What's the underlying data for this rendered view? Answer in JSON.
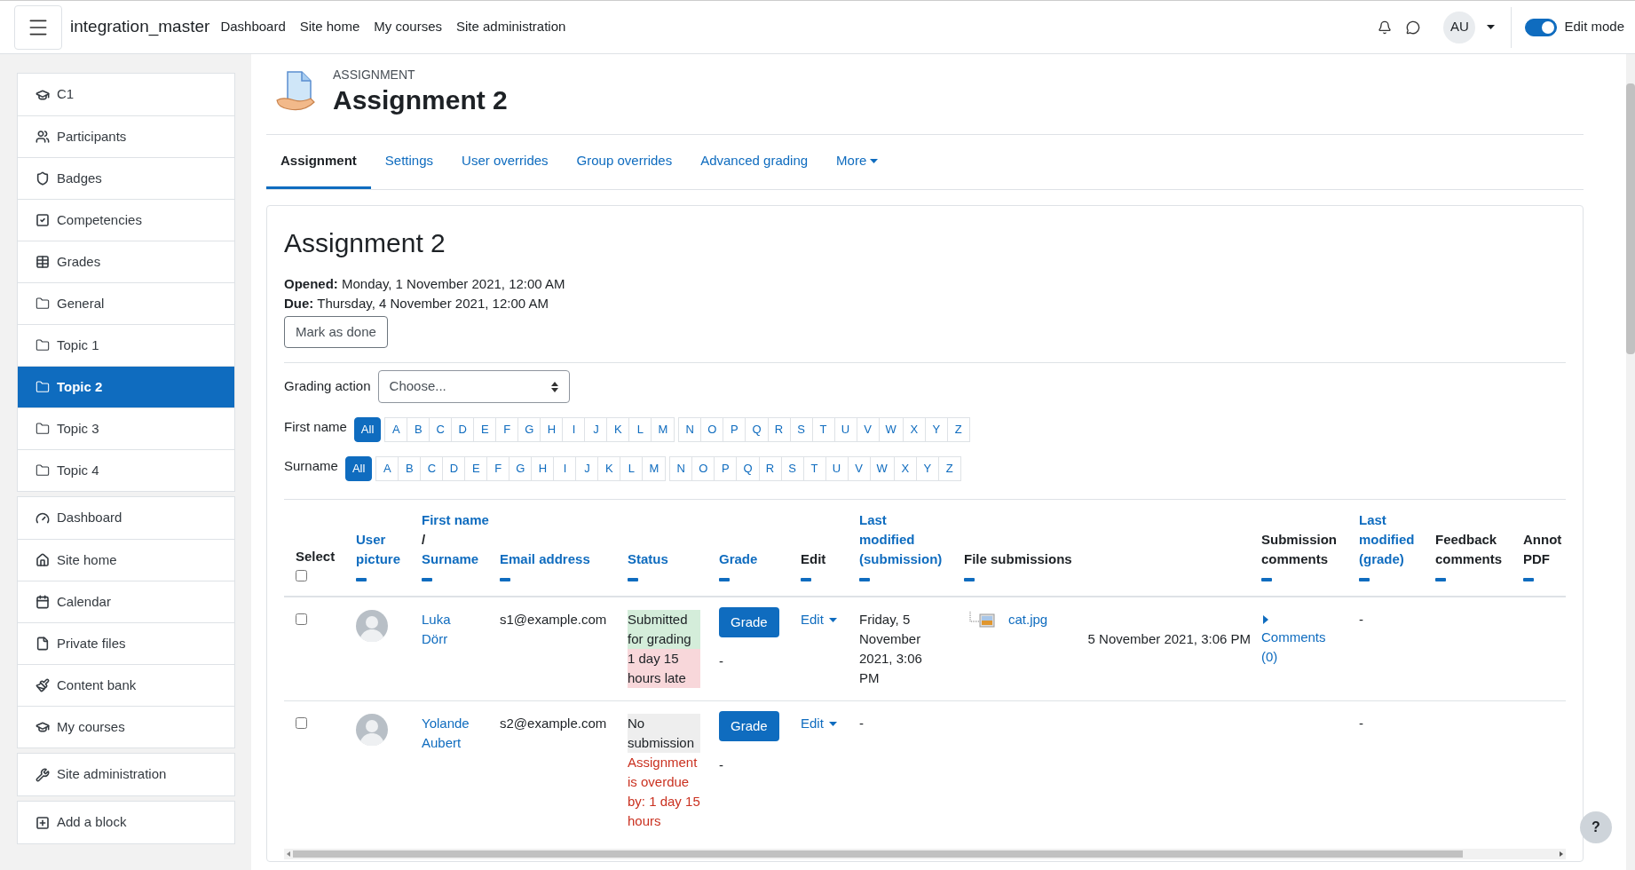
{
  "nav": {
    "site_name": "integration_master",
    "links": [
      "Dashboard",
      "Site home",
      "My courses",
      "Site administration"
    ],
    "avatar": "AU",
    "edit_mode": {
      "label": "Edit mode",
      "on": true
    }
  },
  "sidebar": {
    "groups": [
      [
        {
          "label": "C1",
          "kind": "course",
          "selected": false
        },
        {
          "label": "Participants",
          "kind": "participants",
          "selected": false
        },
        {
          "label": "Badges",
          "kind": "badges",
          "selected": false
        },
        {
          "label": "Competencies",
          "kind": "competencies",
          "selected": false
        },
        {
          "label": "Grades",
          "kind": "grades",
          "selected": false
        },
        {
          "label": "General",
          "kind": "folder",
          "selected": false
        },
        {
          "label": "Topic 1",
          "kind": "folder",
          "selected": false
        },
        {
          "label": "Topic 2",
          "kind": "folder",
          "selected": true
        },
        {
          "label": "Topic 3",
          "kind": "folder",
          "selected": false
        },
        {
          "label": "Topic 4",
          "kind": "folder",
          "selected": false
        }
      ],
      [
        {
          "label": "Dashboard",
          "kind": "dashboard",
          "selected": false
        },
        {
          "label": "Site home",
          "kind": "home",
          "selected": false
        },
        {
          "label": "Calendar",
          "kind": "calendar",
          "selected": false
        },
        {
          "label": "Private files",
          "kind": "file",
          "selected": false
        },
        {
          "label": "Content bank",
          "kind": "brush",
          "selected": false
        },
        {
          "label": "My courses",
          "kind": "course",
          "selected": false
        }
      ],
      [
        {
          "label": "Site administration",
          "kind": "admin",
          "selected": false
        }
      ],
      [
        {
          "label": "Add a block",
          "kind": "add",
          "selected": false
        }
      ]
    ]
  },
  "header": {
    "kicker": "ASSIGNMENT",
    "title": "Assignment 2"
  },
  "tabs": [
    {
      "label": "Assignment",
      "selected": true,
      "kind": "tab"
    },
    {
      "label": "Settings",
      "selected": false,
      "kind": "tab"
    },
    {
      "label": "User overrides",
      "selected": false,
      "kind": "tab"
    },
    {
      "label": "Group overrides",
      "selected": false,
      "kind": "tab"
    },
    {
      "label": "Advanced grading",
      "selected": false,
      "kind": "tab"
    },
    {
      "label": "More",
      "selected": false,
      "kind": "dropdown"
    }
  ],
  "card": {
    "title": "Assignment 2",
    "dates": [
      {
        "label": "Opened:",
        "value": "Monday, 1 November 2021, 12:00 AM"
      },
      {
        "label": "Due:",
        "value": "Thursday, 4 November 2021, 12:00 AM"
      }
    ],
    "mark_done": "Mark as done",
    "grading_action": {
      "label": "Grading action",
      "value": "Choose..."
    },
    "filters": [
      {
        "label": "First name",
        "groups": [
          [
            {
              "label": "All",
              "selected": true
            }
          ],
          [
            {
              "label": "A",
              "selected": false
            },
            {
              "label": "B",
              "selected": false
            },
            {
              "label": "C",
              "selected": false
            },
            {
              "label": "D",
              "selected": false
            },
            {
              "label": "E",
              "selected": false
            },
            {
              "label": "F",
              "selected": false
            },
            {
              "label": "G",
              "selected": false
            },
            {
              "label": "H",
              "selected": false
            },
            {
              "label": "I",
              "selected": false
            },
            {
              "label": "J",
              "selected": false
            },
            {
              "label": "K",
              "selected": false
            },
            {
              "label": "L",
              "selected": false
            },
            {
              "label": "M",
              "selected": false
            }
          ],
          [
            {
              "label": "N",
              "selected": false
            },
            {
              "label": "O",
              "selected": false
            },
            {
              "label": "P",
              "selected": false
            },
            {
              "label": "Q",
              "selected": false
            },
            {
              "label": "R",
              "selected": false
            },
            {
              "label": "S",
              "selected": false
            },
            {
              "label": "T",
              "selected": false
            },
            {
              "label": "U",
              "selected": false
            },
            {
              "label": "V",
              "selected": false
            },
            {
              "label": "W",
              "selected": false
            },
            {
              "label": "X",
              "selected": false
            },
            {
              "label": "Y",
              "selected": false
            },
            {
              "label": "Z",
              "selected": false
            }
          ]
        ]
      },
      {
        "label": "Surname",
        "groups": [
          [
            {
              "label": "All",
              "selected": true
            }
          ],
          [
            {
              "label": "A",
              "selected": false
            },
            {
              "label": "B",
              "selected": false
            },
            {
              "label": "C",
              "selected": false
            },
            {
              "label": "D",
              "selected": false
            },
            {
              "label": "E",
              "selected": false
            },
            {
              "label": "F",
              "selected": false
            },
            {
              "label": "G",
              "selected": false
            },
            {
              "label": "H",
              "selected": false
            },
            {
              "label": "I",
              "selected": false
            },
            {
              "label": "J",
              "selected": false
            },
            {
              "label": "K",
              "selected": false
            },
            {
              "label": "L",
              "selected": false
            },
            {
              "label": "M",
              "selected": false
            }
          ],
          [
            {
              "label": "N",
              "selected": false
            },
            {
              "label": "O",
              "selected": false
            },
            {
              "label": "P",
              "selected": false
            },
            {
              "label": "Q",
              "selected": false
            },
            {
              "label": "R",
              "selected": false
            },
            {
              "label": "S",
              "selected": false
            },
            {
              "label": "T",
              "selected": false
            },
            {
              "label": "U",
              "selected": false
            },
            {
              "label": "V",
              "selected": false
            },
            {
              "label": "W",
              "selected": false
            },
            {
              "label": "X",
              "selected": false
            },
            {
              "label": "Y",
              "selected": false
            },
            {
              "label": "Z",
              "selected": false
            }
          ]
        ]
      }
    ]
  },
  "table": {
    "columns": [
      {
        "kind": "select",
        "label": "Select",
        "checked": false
      },
      {
        "kind": "link",
        "label": "User picture"
      },
      {
        "kind": "pair",
        "parts": [
          "First name",
          "Surname"
        ],
        "separator": "/"
      },
      {
        "kind": "link",
        "label": "Email address"
      },
      {
        "kind": "link",
        "label": "Status"
      },
      {
        "kind": "link",
        "label": "Grade"
      },
      {
        "kind": "plain",
        "label": "Edit"
      },
      {
        "kind": "link",
        "label": "Last modified (submission)"
      },
      {
        "kind": "plain",
        "label": "File submissions"
      },
      {
        "kind": "plain",
        "label": "Submission comments"
      },
      {
        "kind": "link",
        "label": "Last modified (grade)"
      },
      {
        "kind": "plain",
        "label": "Feedback comments"
      },
      {
        "kind": "plain",
        "label": "Annot PDF"
      }
    ],
    "rows": [
      {
        "checked": false,
        "name": "Luka Dörr",
        "email": "s1@example.com",
        "status": [
          {
            "text": "Submitted for grading",
            "kind": "submitted"
          },
          {
            "text": "1 day 15 hours late",
            "kind": "late"
          }
        ],
        "grade_button": "Grade",
        "grade": "-",
        "edit": "Edit",
        "modified": "Friday, 5 November 2021, 3:06 PM",
        "file": {
          "name": "cat.jpg",
          "date": "5 November 2021, 3:06 PM"
        },
        "comments": "Comments (0)",
        "grade_modified": "-"
      },
      {
        "checked": false,
        "name": "Yolande Aubert",
        "email": "s2@example.com",
        "status": [
          {
            "text": "No submission",
            "kind": "none"
          },
          {
            "text": "Assignment is overdue by: 1 day 15 hours",
            "kind": "overdue"
          }
        ],
        "grade_button": "Grade",
        "grade": "-",
        "edit": "Edit",
        "modified": "-",
        "grade_modified": "-"
      }
    ]
  },
  "help": "?"
}
